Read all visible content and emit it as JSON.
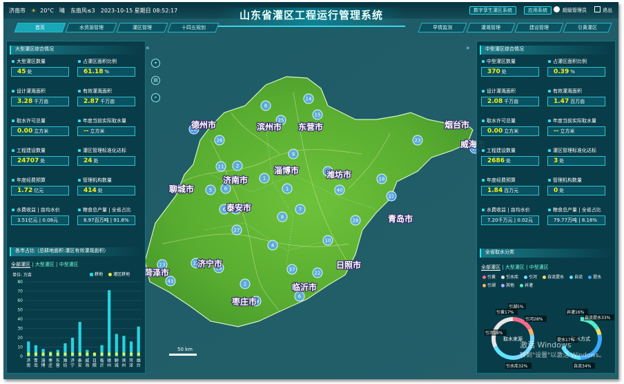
{
  "topbar": {
    "city": "济南市",
    "temp": "20°C",
    "weather": "晴",
    "wind": "东南风≤3",
    "datetime": "2023-10-15 星期日 08:52:17",
    "btn_twin": "数字孪生灌区系统",
    "btn_app": "应用系统",
    "user": "超级管理员",
    "logout": "退出"
  },
  "title": "山东省灌区工程运行管理系统",
  "nav_left": [
    "首页",
    "水资源管理",
    "灌区管理",
    "十四五规划"
  ],
  "nav_right": [
    "早情监测",
    "灌溉管理",
    "建设管理",
    "引黄灌区"
  ],
  "left": {
    "title": "大型灌区综合情况",
    "kpis": [
      {
        "label": "大型灌区数量",
        "value": "45",
        "unit": "处"
      },
      {
        "label": "占灌区面积比例",
        "value": "61.18",
        "unit": "%"
      },
      {
        "label": "设计灌溉面积",
        "value": "3.28",
        "unit": "千万亩"
      },
      {
        "label": "有效灌溉面积",
        "value": "2.87",
        "unit": "千万亩"
      },
      {
        "label": "取水许可总量",
        "value": "0.00",
        "unit": "立方米"
      },
      {
        "label": "年度当前实际取水量",
        "value": "--",
        "unit": "立方米"
      },
      {
        "label": "工程建设数量",
        "value": "24707",
        "unit": "处"
      },
      {
        "label": "灌区管理标准化达标",
        "value": "24",
        "unit": "处"
      },
      {
        "label": "年度经费预算",
        "value": "1.72",
        "unit": "亿元"
      },
      {
        "label": "管理机构数量",
        "value": "414",
        "unit": "处"
      },
      {
        "label": "水费收益 | 亩均水价",
        "value": "",
        "unit": "3.51亿元 | 0.08元"
      },
      {
        "label": "粮食总产量 | 全省占比",
        "value": "",
        "unit": "8.97百万吨 | 91.8%"
      }
    ],
    "chart_title": "各市占比（总耕地面积:灌区有效灌溉面积）",
    "tabs": [
      "全部灌区",
      "大型灌区",
      "中型灌区"
    ]
  },
  "right": {
    "title": "中型灌区综合情况",
    "kpis": [
      {
        "label": "中型灌区数量",
        "value": "370",
        "unit": "处"
      },
      {
        "label": "占灌区面积比例",
        "value": "0.39",
        "unit": "%"
      },
      {
        "label": "设计灌溉面积",
        "value": "2.08",
        "unit": "千万亩"
      },
      {
        "label": "有效灌溉面积",
        "value": "1.47",
        "unit": "百万亩"
      },
      {
        "label": "取水许可总量",
        "value": "0.00",
        "unit": "立方米"
      },
      {
        "label": "年度当前实际取水量",
        "value": "--",
        "unit": "立方米"
      },
      {
        "label": "工程建设数量",
        "value": "2686",
        "unit": "处"
      },
      {
        "label": "灌区管理标准化达标",
        "value": "3",
        "unit": "处"
      },
      {
        "label": "年度经费预算",
        "value": "1.84",
        "unit": "百万元"
      },
      {
        "label": "管理机构数量",
        "value": "0",
        "unit": "处"
      },
      {
        "label": "水费收益 | 亩均水价",
        "value": "",
        "unit": "7.20千万元 | 0.02元"
      },
      {
        "label": "粮食总产量 | 全省占比",
        "value": "",
        "unit": "79.77万吨 | 8.16%"
      }
    ],
    "water_title": "全省取水分类",
    "tabs": [
      "全部灌区",
      "大型灌区",
      "中型灌区"
    ],
    "legend": [
      "引黄",
      "引水库",
      "引河",
      "自流提水",
      "自流",
      "提水",
      "引湖",
      "其他",
      "井灌"
    ],
    "legend_colors": [
      "#ff6a8a",
      "#e7e7e7",
      "#7ad8ff",
      "#f0e060",
      "#60e3ff",
      "#3aa8ff",
      "#ffb060",
      "#b0b0ff",
      "#58e8c8"
    ],
    "donut1": {
      "center": "取水来源",
      "labels": [
        "引黄17%",
        "引湖5%",
        "引河28%",
        "引河18%",
        "引水库32%"
      ]
    },
    "donut2": {
      "center": "取水方式",
      "labels": [
        "井灌16%",
        "自流提水33%",
        "提水17%",
        "自流34%"
      ]
    }
  },
  "chart_data": {
    "type": "bar",
    "unit_label": "单位: 万亩",
    "series": [
      {
        "name": "耕地",
        "values": [
          16,
          12,
          8,
          5,
          7,
          14,
          20,
          37,
          7,
          4,
          12,
          71,
          24,
          22,
          16,
          32
        ]
      },
      {
        "name": "灌区耕地",
        "values": [
          2.5,
          2.5,
          2.5,
          2.5,
          2.5,
          2.5,
          2.5,
          2.5,
          2.5,
          2.5,
          2.5,
          2.5,
          2.5,
          2.5,
          2.5,
          2.5
        ]
      }
    ],
    "categories": [
      "济南",
      "青岛",
      "淄博",
      "枣庄",
      "东营",
      "潍坊",
      "济宁",
      "泰安",
      "威海",
      "日照",
      "临沂",
      "德州",
      "聊城",
      "滨州",
      "菏泽",
      "烟台"
    ],
    "ylim": [
      0,
      80
    ],
    "yticks": [
      0,
      10,
      20,
      30,
      40,
      50,
      60,
      70,
      80
    ],
    "colors": {
      "bar": "#26d3e0",
      "line": "#f4ef3a"
    }
  },
  "map": {
    "cities": [
      {
        "name": "滨州市"
      },
      {
        "name": "东营市"
      },
      {
        "name": "德州市"
      },
      {
        "name": "烟台市"
      },
      {
        "name": "聊城市"
      },
      {
        "name": "济南市"
      },
      {
        "name": "淄博市"
      },
      {
        "name": "潍坊市"
      },
      {
        "name": "泰安市"
      },
      {
        "name": "济宁市"
      },
      {
        "name": "菏泽市"
      },
      {
        "name": "临沂市"
      },
      {
        "name": "枣庄市"
      },
      {
        "name": "日照市"
      },
      {
        "name": "青岛市"
      },
      {
        "name": "威海市"
      }
    ],
    "markers": [
      "15",
      "8",
      "25",
      "14",
      "23",
      "26",
      "11",
      "2",
      "6",
      "1",
      "7",
      "18",
      "40",
      "1",
      "10",
      "27",
      "6",
      "8",
      "10",
      "37",
      "2",
      "18",
      "6",
      "12",
      "13",
      "43",
      "19",
      "27",
      "22",
      "4",
      "28",
      "28",
      "15",
      "9",
      "5",
      "7"
    ],
    "scale": "50 km"
  },
  "watermark": [
    "激活 Windows",
    "转到\"设置\"以激活 Windows。"
  ]
}
